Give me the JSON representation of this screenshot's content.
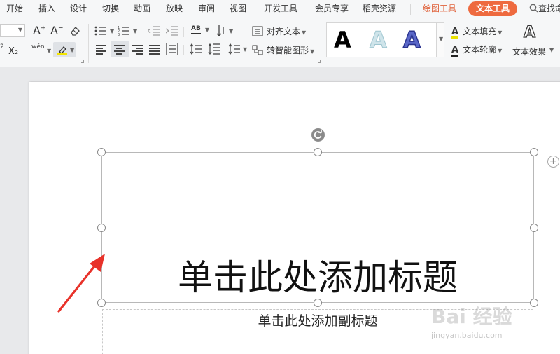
{
  "menu": {
    "tabs": [
      "开始",
      "插入",
      "设计",
      "切换",
      "动画",
      "放映",
      "审阅",
      "视图",
      "开发工具",
      "会员专享",
      "稻壳资源"
    ],
    "drawing_tools": "绘图工具",
    "text_tools": "文本工具",
    "search": "查找命"
  },
  "ribbon": {
    "spacing_control": "AB",
    "align_text": "对齐文本",
    "convert_smartart": "转智能图形",
    "text_fill": "文本填充",
    "text_outline": "文本轮廓",
    "text_effect": "文本效果",
    "gallery_letter": "A",
    "phonetic": "wén",
    "superscript_digit": "2",
    "subscript_label": "X₂"
  },
  "slide": {
    "title_placeholder": "单击此处添加标题",
    "subtitle_placeholder": "单击此处添加副标题"
  },
  "watermark": {
    "logo": "Bai 经验",
    "url": "jingyan.baidu.com"
  },
  "colors": {
    "accent": "#ee6a3f",
    "annotation_arrow": "#e8322a"
  }
}
